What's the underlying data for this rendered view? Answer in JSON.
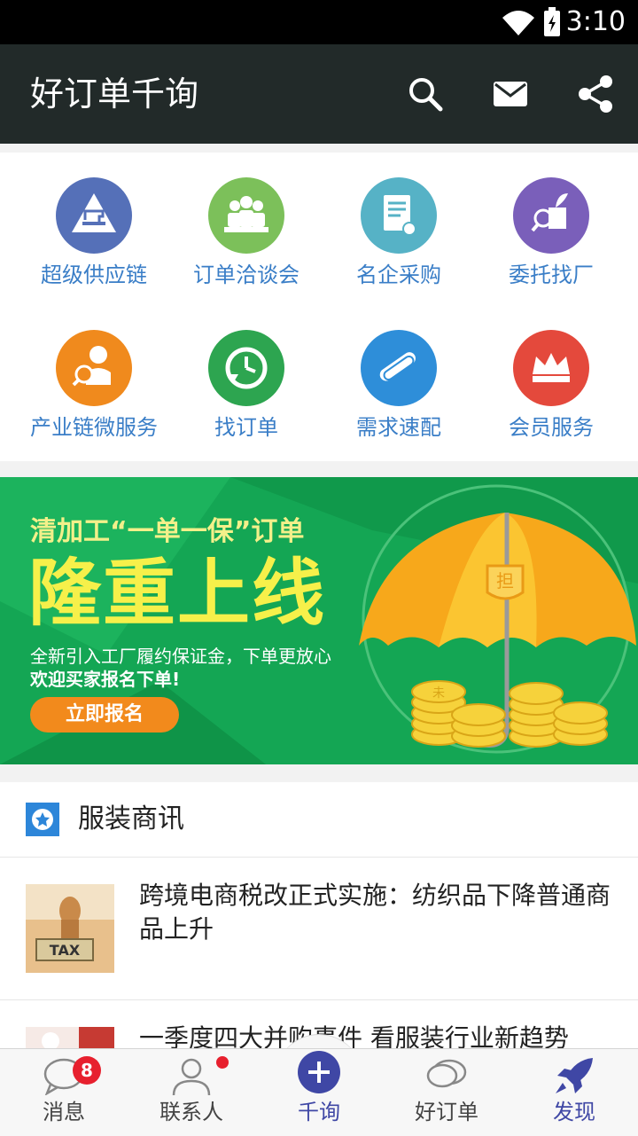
{
  "status_bar": {
    "time": "3:10"
  },
  "app_bar": {
    "title": "好订单千询"
  },
  "grid": [
    {
      "label": "超级供应链",
      "icon": "sewing-machine-icon",
      "color": "#5570b8"
    },
    {
      "label": "订单洽谈会",
      "icon": "meeting-people-icon",
      "color": "#7cc05a"
    },
    {
      "label": "名企采购",
      "icon": "certificate-document-icon",
      "color": "#56b2c6"
    },
    {
      "label": "委托找厂",
      "icon": "search-factory-icon",
      "color": "#7a5fba"
    },
    {
      "label": "产业链微服务",
      "icon": "service-person-icon",
      "color": "#f08a1d"
    },
    {
      "label": "找订单",
      "icon": "clock-refresh-icon",
      "color": "#2da550"
    },
    {
      "label": "需求速配",
      "icon": "handshake-icon",
      "color": "#2e8ed9"
    },
    {
      "label": "会员服务",
      "icon": "crown-icon",
      "color": "#e4493c"
    }
  ],
  "banner": {
    "line1": "清加工“一单一保”订单",
    "headline": "隆重上线",
    "desc1": "全新引入工厂履约保证金，下单更放心",
    "desc2": "欢迎买家报名下单!",
    "cta": "立即报名",
    "shield_char": "担",
    "coin_char": "未"
  },
  "news": {
    "section_title": "服装商讯",
    "items": [
      {
        "text": "跨境电商税改正式实施：纺织品下降普通商品上升",
        "thumb_label": "TAX"
      },
      {
        "text": "一季度四大并购事件 看服装行业新趋势",
        "thumb_label": ""
      }
    ]
  },
  "tabbar": {
    "tabs": [
      {
        "label": "消息",
        "badge": "8"
      },
      {
        "label": "联系人"
      },
      {
        "label": "千询"
      },
      {
        "label": "好订单"
      },
      {
        "label": "发现"
      }
    ]
  },
  "colors": {
    "accent": "#3a7ec7",
    "tab_active": "#3f47a5",
    "appbar": "#222a29",
    "badge": "#e7202e"
  }
}
